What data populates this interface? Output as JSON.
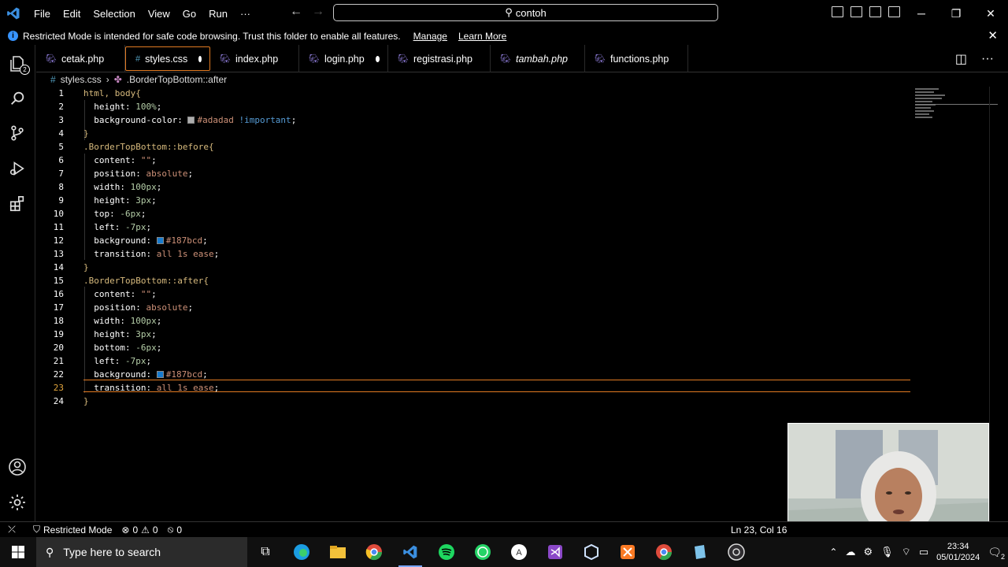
{
  "menu": [
    "File",
    "Edit",
    "Selection",
    "View",
    "Go",
    "Run",
    "···"
  ],
  "command_center": "contoh",
  "banner": {
    "text": "Restricted Mode is intended for safe code browsing. Trust this folder to enable all features.",
    "manage": "Manage",
    "learn_more": "Learn More"
  },
  "activity": {
    "explorer_badge": "2"
  },
  "tabs": [
    {
      "label": "cetak.php",
      "icon": "php-icon"
    },
    {
      "label": "styles.css",
      "icon": "css-icon"
    },
    {
      "label": "index.php",
      "icon": "php-icon"
    },
    {
      "label": "login.php",
      "icon": "php-icon"
    },
    {
      "label": "registrasi.php",
      "icon": "php-icon"
    },
    {
      "label": "tambah.php",
      "icon": "php-icon"
    },
    {
      "label": "functions.php",
      "icon": "php-icon"
    }
  ],
  "breadcrumb": {
    "file": "styles.css",
    "symbol": ".BorderTopBottom::after"
  },
  "code": {
    "l1": "html, body{",
    "l2p": "height:",
    "l2v": "100%",
    "l3p": "background-color:",
    "l3v": "#adadad",
    "l3k": "!important",
    "l4": "}",
    "l5": ".BorderTopBottom::before{",
    "l6p": "content:",
    "l6v": "\"\"",
    "l7p": "position:",
    "l7v": "absolute",
    "l8p": "width:",
    "l8v": "100px",
    "l9p": "height:",
    "l9v": "3px",
    "l10p": "top:",
    "l10v": "-6px",
    "l11p": "left:",
    "l11v": "-7px",
    "l12p": "background:",
    "l12v": "#187bcd",
    "l13p": "transition:",
    "l13v": "all 1s ease",
    "l14": "}",
    "l15": ".BorderTopBottom::after{",
    "l16p": "content:",
    "l16v": "\"\"",
    "l17p": "position:",
    "l17v": "absolute",
    "l18p": "width:",
    "l18v": "100px",
    "l19p": "height:",
    "l19v": "3px",
    "l20p": "bottom:",
    "l20v": "-6px",
    "l21p": "left:",
    "l21v": "-7px",
    "l22p": "background:",
    "l22v": "#187bcd",
    "l23p": "transition:",
    "l23v": "all 1s ease",
    "l24": "}"
  },
  "line_numbers": [
    "1",
    "2",
    "3",
    "4",
    "5",
    "6",
    "7",
    "8",
    "9",
    "10",
    "11",
    "12",
    "13",
    "14",
    "15",
    "16",
    "17",
    "18",
    "19",
    "20",
    "21",
    "22",
    "23",
    "24"
  ],
  "status": {
    "restricted": "Restricted Mode",
    "errors": "0",
    "warnings": "0",
    "ports": "0",
    "position": "Ln 23, Col 16"
  },
  "taskbar": {
    "search_placeholder": "Type here to search",
    "time": "23:34",
    "date": "05/01/2024",
    "notifications": "2"
  },
  "colors": {
    "accent": "#e27b22",
    "swatch_gray": "#adadad",
    "swatch_blue": "#187bcd"
  }
}
